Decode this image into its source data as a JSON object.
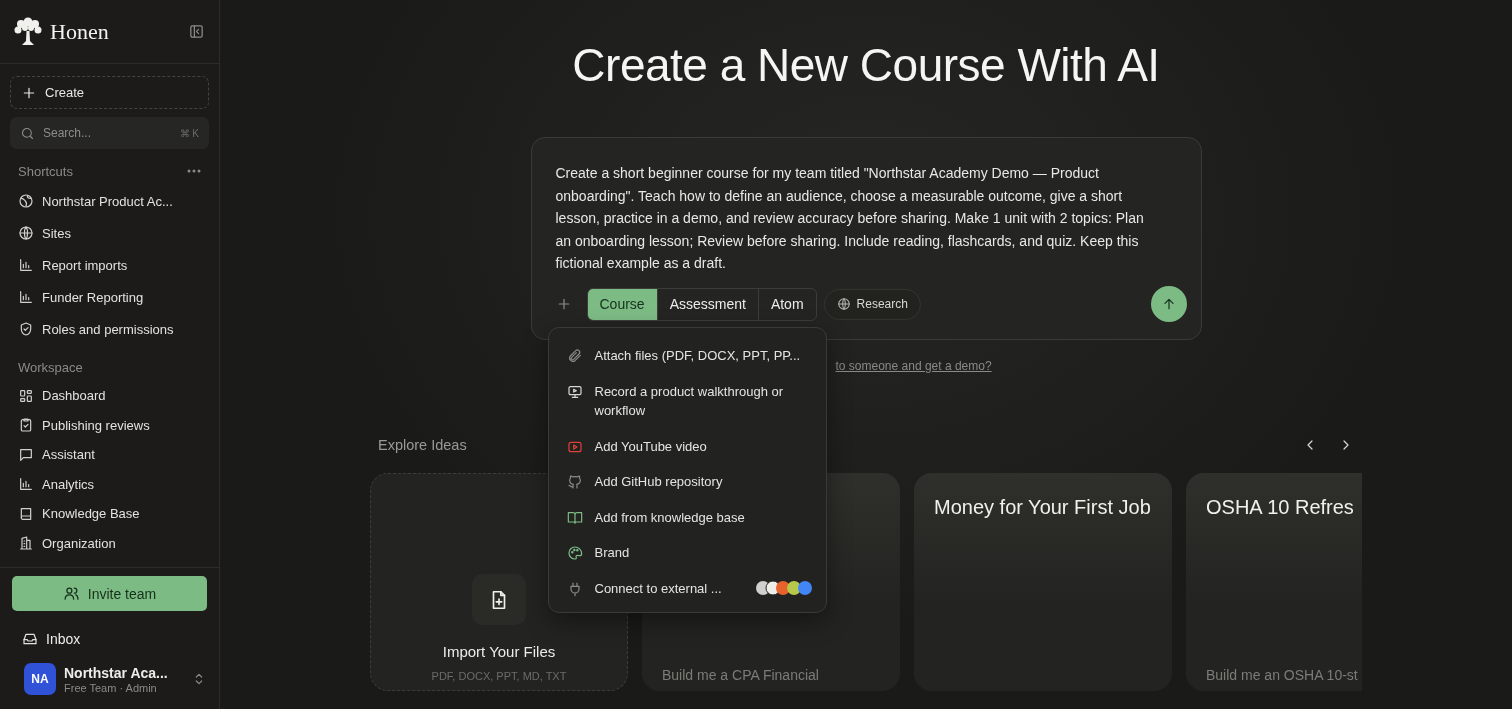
{
  "sidebar": {
    "brand": "Honen",
    "create_label": "Create",
    "search": {
      "placeholder": "Search...",
      "shortcut": "⌘ K"
    },
    "shortcuts_title": "Shortcuts",
    "shortcuts": [
      {
        "label": "Northstar Product Ac..."
      },
      {
        "label": "Sites"
      },
      {
        "label": "Report imports"
      },
      {
        "label": "Funder Reporting"
      },
      {
        "label": "Roles and permissions"
      }
    ],
    "workspace_title": "Workspace",
    "workspace": [
      {
        "label": "Dashboard"
      },
      {
        "label": "Publishing reviews"
      },
      {
        "label": "Assistant"
      },
      {
        "label": "Analytics"
      },
      {
        "label": "Knowledge Base"
      },
      {
        "label": "Organization"
      }
    ],
    "invite_label": "Invite team",
    "inbox_label": "Inbox",
    "account": {
      "initials": "NA",
      "name": "Northstar Aca...",
      "role": "Free Team · Admin"
    }
  },
  "main": {
    "title": "Create a New Course With AI",
    "prompt": {
      "value": "Create a short beginner course for my team titled \"Northstar Academy Demo — Product onboarding\". Teach how to define an audience, choose a measurable outcome, give a short lesson, practice in a demo, and review accuracy before sharing. Make 1 unit with 2 topics: Plan an onboarding lesson; Review before sharing. Include reading, flashcards, and quiz. Keep this fictional example as a draft.",
      "modes": [
        {
          "label": "Course",
          "selected": true
        },
        {
          "label": "Assessment",
          "selected": false
        },
        {
          "label": "Atom",
          "selected": false
        }
      ],
      "research_label": "Research"
    },
    "attach_menu": [
      {
        "label": "Attach files (PDF, DOCX, PPT, PP..."
      },
      {
        "label": "Record a product walkthrough or workflow"
      },
      {
        "label": "Add YouTube video"
      },
      {
        "label": "Add GitHub repository"
      },
      {
        "label": "Add from knowledge base"
      },
      {
        "label": "Brand"
      },
      {
        "label": "Connect to external ..."
      }
    ],
    "demo_link": "to someone and get a demo?",
    "explore_title": "Explore Ideas",
    "cards": [
      {
        "kind": "import",
        "title": "Import Your Files",
        "subtitle": "PDF, DOCX, PPT, MD, TXT"
      },
      {
        "kind": "idea",
        "prompt": "Build me a CPA Financial"
      },
      {
        "kind": "idea",
        "title": "Money for Your First Job"
      },
      {
        "kind": "idea",
        "title": "OSHA 10 Refres",
        "prompt": "Build me an OSHA 10-st"
      }
    ]
  }
}
